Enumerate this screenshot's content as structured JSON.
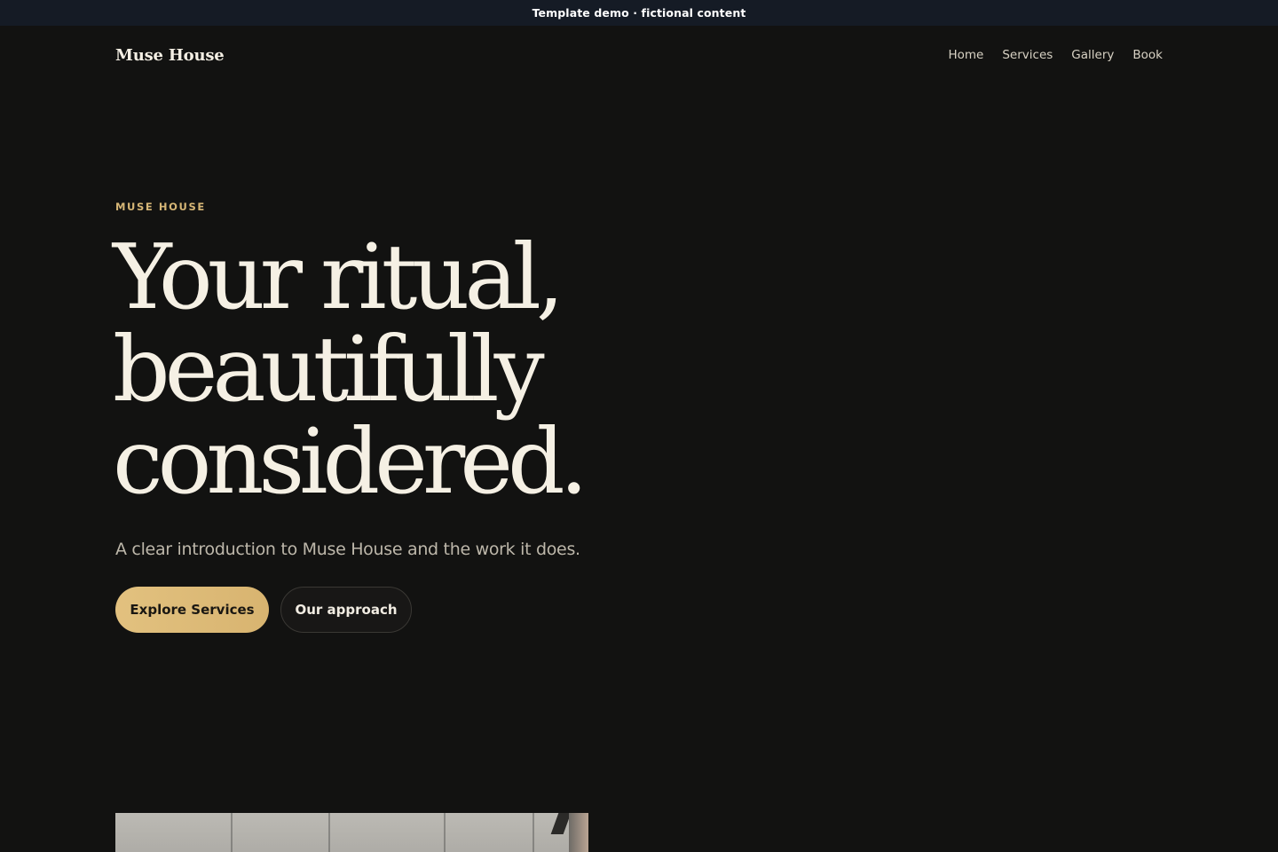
{
  "banner": {
    "text": "Template demo · fictional content"
  },
  "nav": {
    "brand": "Muse House",
    "links": [
      "Home",
      "Services",
      "Gallery",
      "Book"
    ]
  },
  "hero": {
    "eyebrow": "MUSE HOUSE",
    "headline": [
      "Your ritual,",
      "beautifully",
      "considered."
    ],
    "subtitle": "A clear introduction to Muse House and the work it does.",
    "primary_cta": "Explore Services",
    "secondary_cta": "Our approach"
  },
  "colors": {
    "background": "#121211",
    "banner": "#151b25",
    "accent_gold": "#d6b676",
    "headline_text": "#f5f0e4"
  }
}
